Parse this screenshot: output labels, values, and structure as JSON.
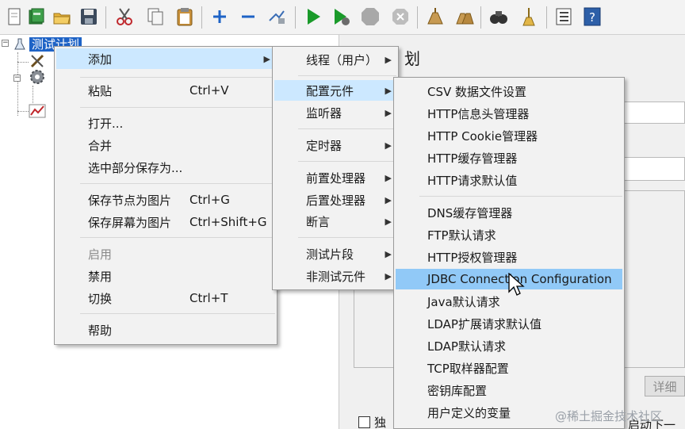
{
  "tree": {
    "root_label": "测试计划"
  },
  "right_panel": {
    "title_fragment": "划",
    "details_button": "详细",
    "independent_checkbox_label": "独",
    "start_next_fragment": "启动下一个"
  },
  "context_menu": {
    "items": [
      {
        "label": "添加",
        "shortcut": "",
        "submenu": true
      },
      {
        "label": "粘贴",
        "shortcut": "Ctrl+V"
      },
      {
        "label": "打开...",
        "shortcut": ""
      },
      {
        "label": "合并",
        "shortcut": ""
      },
      {
        "label": "选中部分保存为...",
        "shortcut": ""
      },
      {
        "label": "保存节点为图片",
        "shortcut": "Ctrl+G"
      },
      {
        "label": "保存屏幕为图片",
        "shortcut": "Ctrl+Shift+G"
      },
      {
        "label": "启用",
        "shortcut": "",
        "disabled": true
      },
      {
        "label": "禁用",
        "shortcut": ""
      },
      {
        "label": "切换",
        "shortcut": "Ctrl+T"
      },
      {
        "label": "帮助",
        "shortcut": ""
      }
    ]
  },
  "add_submenu": {
    "items": [
      {
        "label": "线程（用户）"
      },
      {
        "label": "配置元件"
      },
      {
        "label": "监听器"
      },
      {
        "label": "定时器"
      },
      {
        "label": "前置处理器"
      },
      {
        "label": "后置处理器"
      },
      {
        "label": "断言"
      },
      {
        "label": "测试片段"
      },
      {
        "label": "非测试元件"
      }
    ]
  },
  "config_submenu": {
    "items": [
      {
        "label": "CSV 数据文件设置"
      },
      {
        "label": "HTTP信息头管理器"
      },
      {
        "label": "HTTP Cookie管理器"
      },
      {
        "label": "HTTP缓存管理器"
      },
      {
        "label": "HTTP请求默认值"
      },
      {
        "label": "DNS缓存管理器"
      },
      {
        "label": "FTP默认请求"
      },
      {
        "label": "HTTP授权管理器"
      },
      {
        "label": "JDBC Connection Configuration"
      },
      {
        "label": "Java默认请求"
      },
      {
        "label": "LDAP扩展请求默认值"
      },
      {
        "label": "LDAP默认请求"
      },
      {
        "label": "TCP取样器配置"
      },
      {
        "label": "密钥库配置"
      },
      {
        "label": "用户定义的变量"
      }
    ]
  },
  "watermark": "@稀土掘金技术社区",
  "colors": {
    "menu_highlight": "#91c9f7",
    "tree_selection": "#1e63c6",
    "run_green": "#1a9a2a"
  },
  "toolbar_icons": [
    "new-icon",
    "templates-icon",
    "open-icon",
    "save-icon",
    "cut-icon",
    "copy-icon",
    "paste-icon",
    "expand-icon",
    "collapse-icon",
    "toggle-icon",
    "start-icon",
    "start-no-pause-icon",
    "stop-icon",
    "shutdown-icon",
    "clear-icon",
    "clear-all-icon",
    "search-icon",
    "reset-search-icon",
    "function-helper-icon",
    "help-icon"
  ]
}
